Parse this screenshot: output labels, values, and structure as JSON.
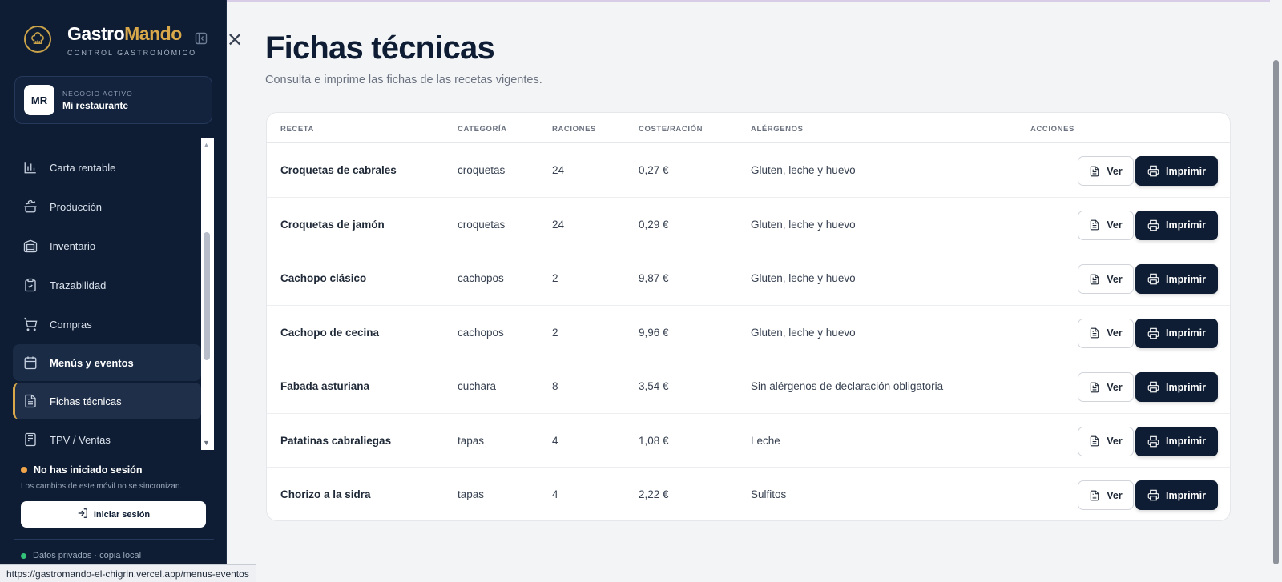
{
  "brand": {
    "name_part1": "Gastro",
    "name_part2": "Mando",
    "subtitle": "CONTROL GASTRONÓMICO"
  },
  "business": {
    "avatar": "MR",
    "label": "NEGOCIO ACTIVO",
    "name": "Mi restaurante"
  },
  "nav": {
    "items": [
      {
        "label": "Carta rentable",
        "icon": "bar-chart-icon"
      },
      {
        "label": "Producción",
        "icon": "cooking-pot-icon"
      },
      {
        "label": "Inventario",
        "icon": "warehouse-icon"
      },
      {
        "label": "Trazabilidad",
        "icon": "clipboard-check-icon"
      },
      {
        "label": "Compras",
        "icon": "cart-icon"
      },
      {
        "label": "Menús y eventos",
        "icon": "calendar-icon"
      },
      {
        "label": "Fichas técnicas",
        "icon": "document-icon"
      },
      {
        "label": "TPV / Ventas",
        "icon": "register-icon"
      }
    ]
  },
  "session": {
    "title": "No has iniciado sesión",
    "subtitle": "Los cambios de este móvil no se sincronizan.",
    "login_label": "Iniciar sesión",
    "privacy": "Datos privados · copia local"
  },
  "status_url": "https://gastromando-el-chigrin.vercel.app/menus-eventos",
  "page": {
    "title": "Fichas técnicas",
    "subtitle": "Consulta e imprime las fichas de las recetas vigentes."
  },
  "table": {
    "headers": {
      "recipe": "RECETA",
      "category": "CATEGORÍA",
      "portions": "RACIONES",
      "cost": "COSTE/RACIÓN",
      "allergens": "ALÉRGENOS",
      "actions": "ACCIONES"
    },
    "view_label": "Ver",
    "print_label": "Imprimir",
    "rows": [
      {
        "recipe": "Croquetas de cabrales",
        "category": "croquetas",
        "portions": "24",
        "cost": "0,27 €",
        "allergens": "Gluten, leche y huevo"
      },
      {
        "recipe": "Croquetas de jamón",
        "category": "croquetas",
        "portions": "24",
        "cost": "0,29 €",
        "allergens": "Gluten, leche y huevo"
      },
      {
        "recipe": "Cachopo clásico",
        "category": "cachopos",
        "portions": "2",
        "cost": "9,87 €",
        "allergens": "Gluten, leche y huevo"
      },
      {
        "recipe": "Cachopo de cecina",
        "category": "cachopos",
        "portions": "2",
        "cost": "9,96 €",
        "allergens": "Gluten, leche y huevo"
      },
      {
        "recipe": "Fabada asturiana",
        "category": "cuchara",
        "portions": "8",
        "cost": "3,54 €",
        "allergens": "Sin alérgenos de declaración obligatoria"
      },
      {
        "recipe": "Patatinas cabraliegas",
        "category": "tapas",
        "portions": "4",
        "cost": "1,08 €",
        "allergens": "Leche"
      },
      {
        "recipe": "Chorizo a la sidra",
        "category": "tapas",
        "portions": "4",
        "cost": "2,22 €",
        "allergens": "Sulfitos"
      }
    ]
  },
  "colors": {
    "sidebar_bg": "#0e1d33",
    "accent_gold": "#d8a84b",
    "primary_button": "#0e1d33"
  }
}
